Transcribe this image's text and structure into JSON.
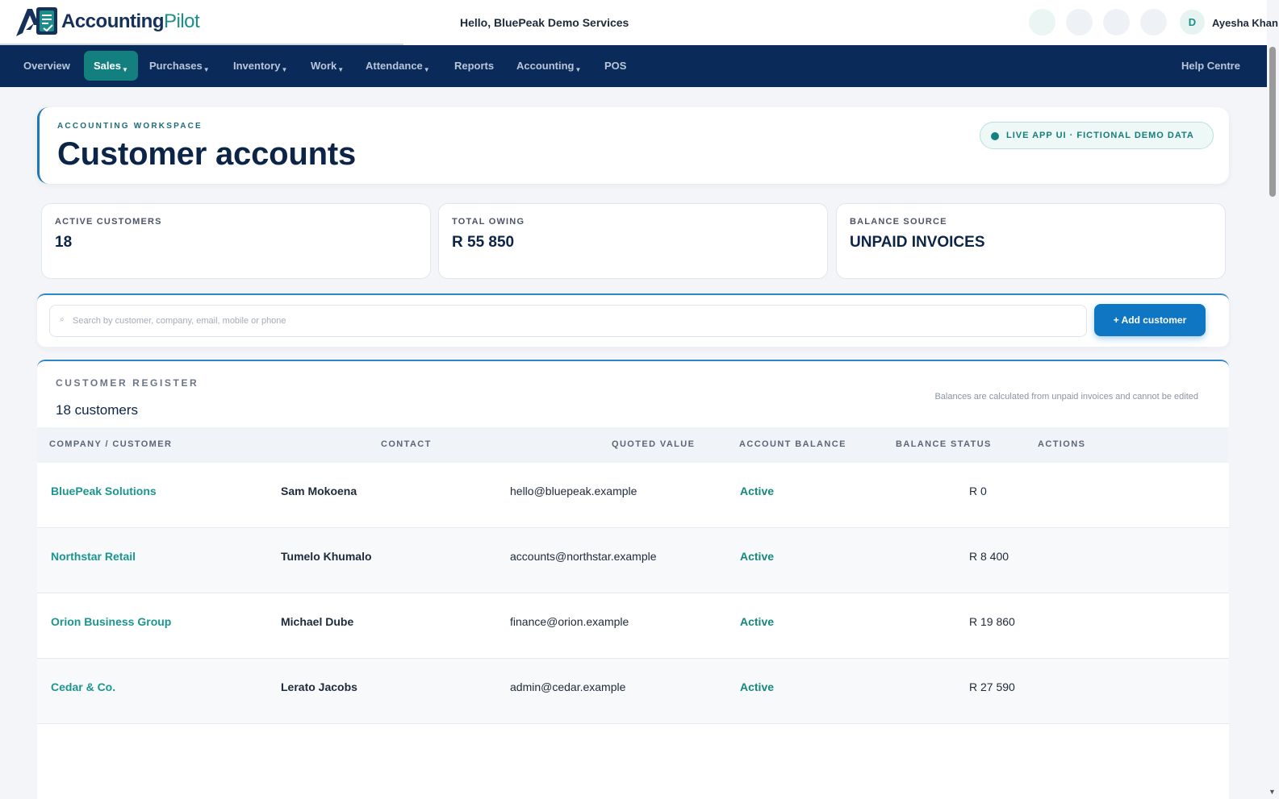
{
  "app": {
    "logo_text_a": "Accounting",
    "logo_text_b": "Pilot",
    "greeting": "Hello, BluePeak Demo Services",
    "user_initial": "D",
    "user_name": "Ayesha Khan"
  },
  "nav": {
    "items": [
      {
        "label": "Overview",
        "dropdown": false
      },
      {
        "label": "Sales",
        "dropdown": true,
        "active": true
      },
      {
        "label": "Purchases",
        "dropdown": true
      },
      {
        "label": "Inventory",
        "dropdown": true
      },
      {
        "label": "Work",
        "dropdown": true
      },
      {
        "label": "Attendance",
        "dropdown": true
      },
      {
        "label": "Reports",
        "dropdown": false
      },
      {
        "label": "Accounting",
        "dropdown": true
      },
      {
        "label": "POS",
        "dropdown": false
      }
    ],
    "help": "Help Centre"
  },
  "header": {
    "eyebrow": "ACCOUNTING WORKSPACE",
    "title": "Customer accounts",
    "badge": "LIVE APP UI · FICTIONAL DEMO DATA"
  },
  "stats": [
    {
      "label": "ACTIVE CUSTOMERS",
      "value": "18"
    },
    {
      "label": "TOTAL OWING",
      "value": "R 55 850"
    },
    {
      "label": "BALANCE SOURCE",
      "value": "UNPAID INVOICES"
    }
  ],
  "search": {
    "icon": "⌕",
    "placeholder": "Search by customer, company, email, mobile or phone",
    "value": "",
    "add_label": "+ Add customer"
  },
  "register": {
    "eyebrow": "CUSTOMER REGISTER",
    "count": "18 customers",
    "note": "Balances are calculated from unpaid invoices and cannot be edited",
    "columns": [
      "COMPANY / CUSTOMER",
      "CONTACT",
      "QUOTED VALUE",
      "ACCOUNT BALANCE",
      "BALANCE STATUS",
      "ACTIONS"
    ],
    "rows": [
      {
        "company": "BluePeak Solutions",
        "contact": "Sam Mokoena",
        "email": "hello@bluepeak.example",
        "status": "Active",
        "balance": "R 0"
      },
      {
        "company": "Northstar Retail",
        "contact": "Tumelo Khumalo",
        "email": "accounts@northstar.example",
        "status": "Active",
        "balance": "R 8 400"
      },
      {
        "company": "Orion Business Group",
        "contact": "Michael Dube",
        "email": "finance@orion.example",
        "status": "Active",
        "balance": "R 19 860"
      },
      {
        "company": "Cedar & Co.",
        "contact": "Lerato Jacobs",
        "email": "admin@cedar.example",
        "status": "Active",
        "balance": "R 27 590"
      }
    ]
  },
  "colors": {
    "nav_bg": "#0a2a5a",
    "active_nav": "#13807f",
    "primary_button": "#0e76c2",
    "link_teal": "#1a9590",
    "title_navy": "#0b2447"
  }
}
